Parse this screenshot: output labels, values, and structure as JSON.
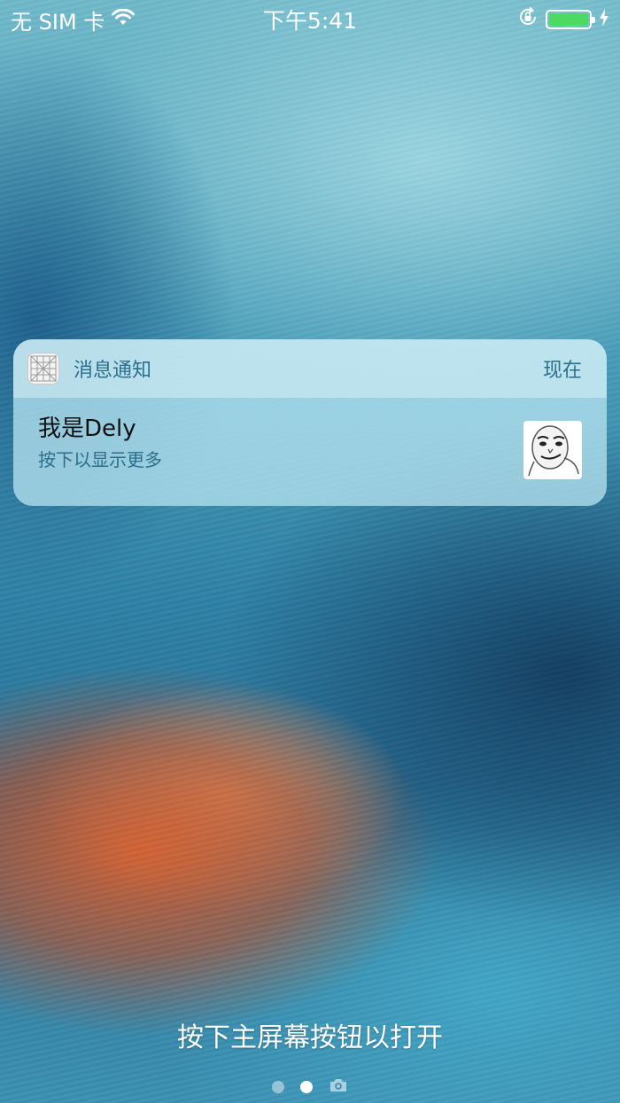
{
  "status_bar": {
    "carrier": "无 SIM 卡",
    "time": "下午5:41",
    "battery_level": 1.0,
    "charging": true,
    "wifi_icon": "wifi-icon",
    "rotation_lock_icon": "rotation-lock-icon"
  },
  "notification": {
    "app_name": "消息通知",
    "time": "现在",
    "title": "我是Dely",
    "subtitle": "按下以显示更多",
    "app_icon": "grid-app-icon",
    "thumbnail": "meme-face-thumbnail"
  },
  "lock_screen": {
    "hint": "按下主屏幕按钮以打开"
  },
  "pager": {
    "pages": [
      "page-dot",
      "page-dot-active",
      "camera-icon"
    ],
    "active_index": 1
  },
  "colors": {
    "battery_fill": "#4cd964",
    "notification_accent": "#2a6f8c"
  }
}
